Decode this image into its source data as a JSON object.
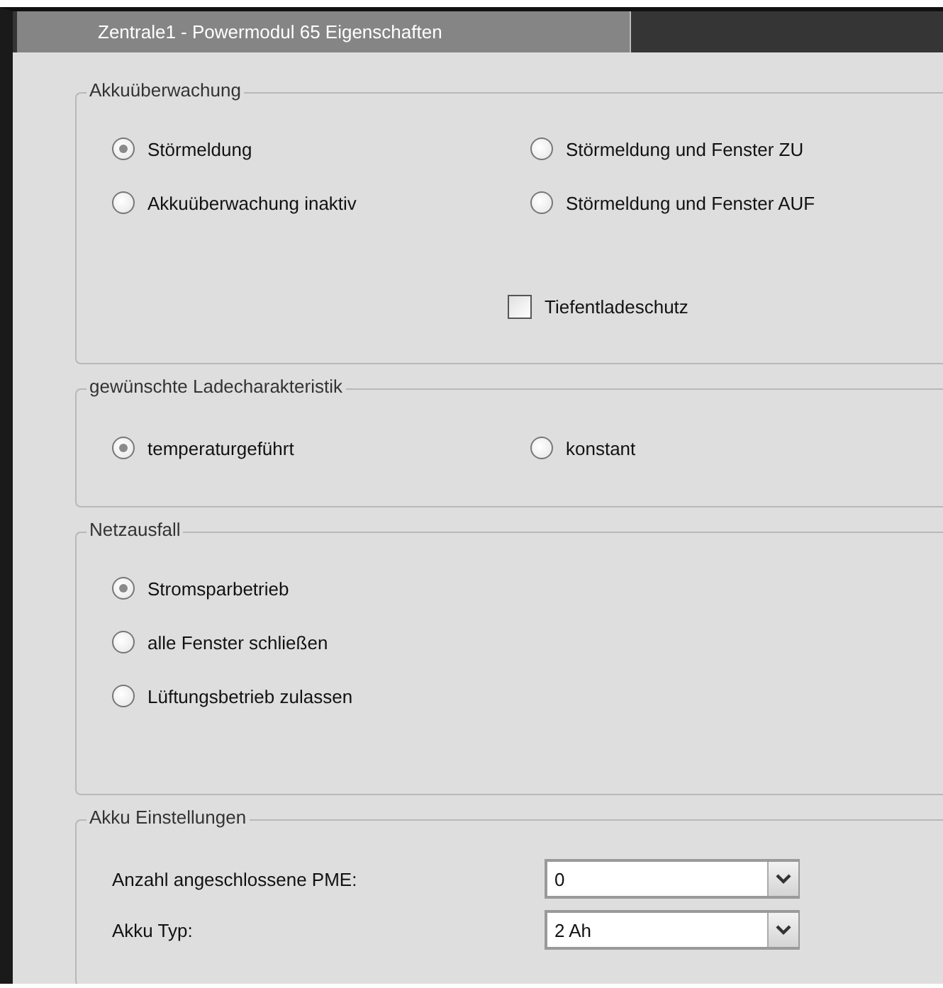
{
  "window": {
    "title": "Zentrale1 - Powermodul 65 Eigenschaften"
  },
  "groups": [
    {
      "kind": "options",
      "title": "Akkuüberwachung",
      "rows": [
        [
          {
            "label": "Störmeldung",
            "selected": true
          },
          {
            "label": "Störmeldung und Fenster ZU",
            "selected": false
          }
        ],
        [
          {
            "label": "Akkuüberwachung inaktiv",
            "selected": false
          },
          {
            "label": "Störmeldung und Fenster AUF",
            "selected": false
          }
        ]
      ],
      "checkbox": {
        "label": "Tiefentladeschutz",
        "checked": false
      }
    },
    {
      "kind": "options",
      "title": "gewünschte Ladecharakteristik",
      "rows": [
        [
          {
            "label": "temperaturgeführt",
            "selected": true
          },
          {
            "label": "konstant",
            "selected": false
          }
        ]
      ]
    },
    {
      "kind": "options",
      "title": "Netzausfall",
      "rows": [
        [
          {
            "label": "Stromsparbetrieb",
            "selected": true
          }
        ],
        [
          {
            "label": "alle Fenster schließen",
            "selected": false
          }
        ],
        [
          {
            "label": "Lüftungsbetrieb zulassen",
            "selected": false
          }
        ]
      ]
    },
    {
      "kind": "settings",
      "title": "Akku Einstellungen",
      "fields": [
        {
          "label": "Anzahl angeschlossene PME:",
          "value": "0"
        },
        {
          "label": "Akku Typ:",
          "value": "2 Ah"
        }
      ]
    }
  ]
}
